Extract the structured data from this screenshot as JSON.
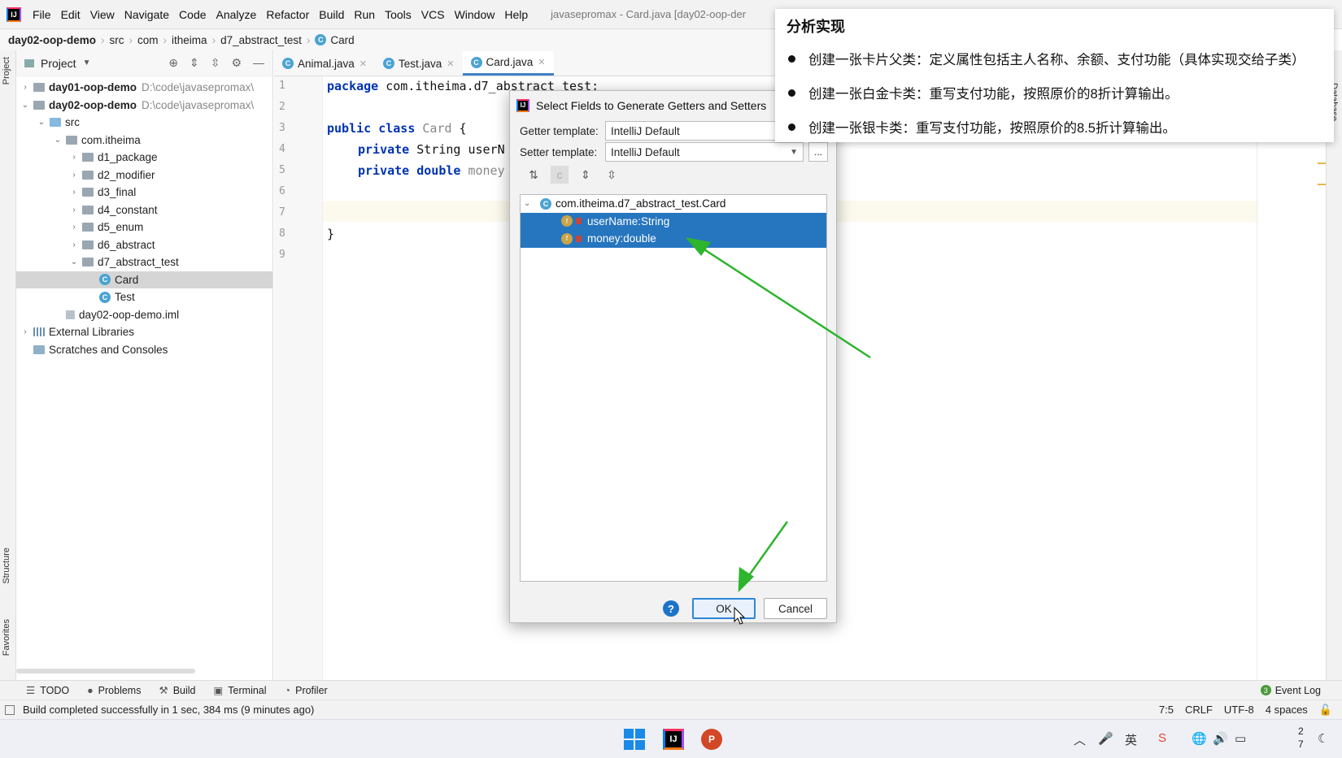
{
  "menubar": {
    "items": [
      "File",
      "Edit",
      "View",
      "Navigate",
      "Code",
      "Analyze",
      "Refactor",
      "Build",
      "Run",
      "Tools",
      "VCS",
      "Window",
      "Help"
    ],
    "window_title": "javasepromax - Card.java [day02-oop-der"
  },
  "breadcrumb": [
    "day02-oop-demo",
    "src",
    "com",
    "itheima",
    "d7_abstract_test",
    "Card"
  ],
  "left_strip": {
    "project": "Project",
    "structure": "Structure",
    "favorites": "Favorites"
  },
  "right_strip": {
    "database": "Database"
  },
  "project_panel": {
    "title": "Project",
    "tree": [
      {
        "label": "day01-oop-demo",
        "hint": "D:\\code\\javasepromax\\",
        "indent": 0,
        "chev": "›",
        "bold": true,
        "icon": "module"
      },
      {
        "label": "day02-oop-demo",
        "hint": "D:\\code\\javasepromax\\",
        "indent": 0,
        "chev": "⌄",
        "bold": true,
        "icon": "module"
      },
      {
        "label": "src",
        "indent": 1,
        "chev": "⌄",
        "icon": "folder-blue"
      },
      {
        "label": "com.itheima",
        "indent": 2,
        "chev": "⌄",
        "icon": "folder"
      },
      {
        "label": "d1_package",
        "indent": 3,
        "chev": "›",
        "icon": "folder"
      },
      {
        "label": "d2_modifier",
        "indent": 3,
        "chev": "›",
        "icon": "folder"
      },
      {
        "label": "d3_final",
        "indent": 3,
        "chev": "›",
        "icon": "folder"
      },
      {
        "label": "d4_constant",
        "indent": 3,
        "chev": "›",
        "icon": "folder"
      },
      {
        "label": "d5_enum",
        "indent": 3,
        "chev": "›",
        "icon": "folder"
      },
      {
        "label": "d6_abstract",
        "indent": 3,
        "chev": "›",
        "icon": "folder"
      },
      {
        "label": "d7_abstract_test",
        "indent": 3,
        "chev": "⌄",
        "icon": "folder"
      },
      {
        "label": "Card",
        "indent": 4,
        "chev": "",
        "icon": "class",
        "selected": true
      },
      {
        "label": "Test",
        "indent": 4,
        "chev": "",
        "icon": "class"
      },
      {
        "label": "day02-oop-demo.iml",
        "indent": 2,
        "chev": "",
        "icon": "file"
      },
      {
        "label": "External Libraries",
        "indent": 0,
        "chev": "›",
        "icon": "libs"
      },
      {
        "label": "Scratches and Consoles",
        "indent": 0,
        "chev": "",
        "icon": "scratch"
      }
    ]
  },
  "tabs": [
    {
      "label": "Animal.java",
      "active": false
    },
    {
      "label": "Test.java",
      "active": false
    },
    {
      "label": "Card.java",
      "active": true
    }
  ],
  "editor": {
    "line_numbers": [
      "1",
      "2",
      "3",
      "4",
      "5",
      "6",
      "7",
      "8",
      "9"
    ],
    "line1_kw": "package",
    "line1_rest": " com.itheima.d7_abstract_test;",
    "line3_kw": "public class",
    "line3_cls": " Card",
    "line3_rest": " {",
    "line4_kw": "private",
    "line4_rest": " String userN",
    "line5_kw": "private double",
    "line5_rest": " money",
    "line8": "}"
  },
  "dialog": {
    "title": "Select Fields to Generate Getters and Setters",
    "getter_label": "Getter template:",
    "getter_value": "IntelliJ Default",
    "setter_label": "Setter template:",
    "setter_value": "IntelliJ Default",
    "dots": "...",
    "root": "com.itheima.d7_abstract_test.Card",
    "fields": [
      "userName:String",
      "money:double"
    ],
    "ok": "OK",
    "cancel": "Cancel",
    "help": "?"
  },
  "overlay": {
    "title": "分析实现",
    "items": [
      "创建一张卡片父类：定义属性包括主人名称、余额、支付功能（具体实现交给子类）",
      "创建一张白金卡类：重写支付功能，按照原价的8折计算输出。",
      "创建一张银卡类：重写支付功能，按照原价的8.5折计算输出。"
    ]
  },
  "bottom_tools": [
    "TODO",
    "Problems",
    "Build",
    "Terminal",
    "Profiler"
  ],
  "event_log": {
    "badge": "3",
    "label": "Event Log"
  },
  "status": {
    "message": "Build completed successfully in 1 sec, 384 ms (9 minutes ago)",
    "position": "7:5",
    "line_sep": "CRLF",
    "encoding": "UTF-8",
    "indent": "4 spaces"
  },
  "taskbar": {
    "clock_top": "2",
    "clock_bottom": "7"
  },
  "colors": {
    "selection": "#2675bf",
    "accent": "#4083c9",
    "arrow": "#2db52d"
  }
}
